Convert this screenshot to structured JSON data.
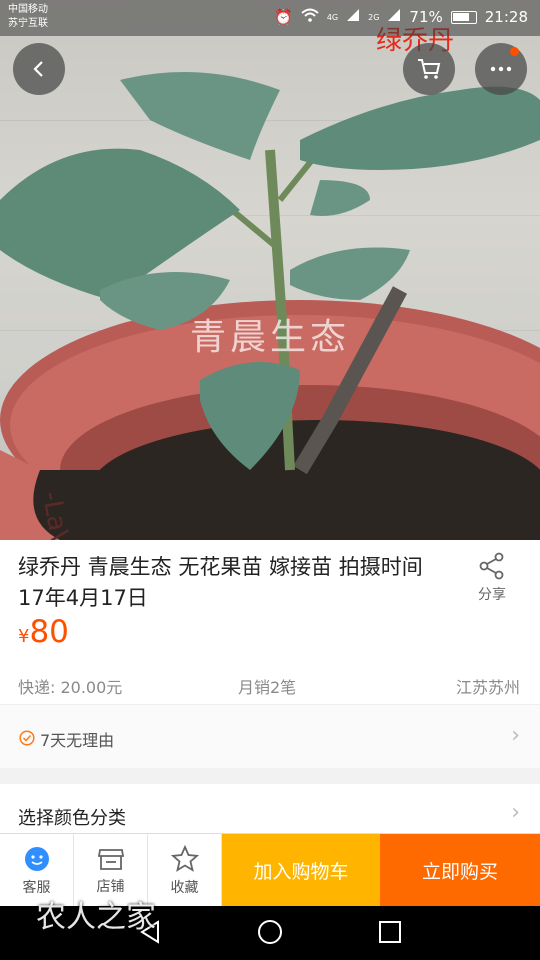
{
  "status": {
    "carrier_line1": "中国移动",
    "carrier_line2": "苏宁互联",
    "signal_net": "4G",
    "signal_net2": "2G",
    "battery": "71%",
    "time": "21:28"
  },
  "photo": {
    "overlay_name": "绿乔丹",
    "watermark": "青晨生态"
  },
  "product": {
    "title": "绿乔丹 青晨生态  无花果苗 嫁接苗 拍摄时间17年4月17日",
    "currency": "¥",
    "price": "80",
    "share_label": "分享",
    "shipping": "快递: 20.00元",
    "monthly_sales": "月销2笔",
    "location": "江苏苏州"
  },
  "guarantee": {
    "label": "7天无理由"
  },
  "sku": {
    "label": "选择颜色分类"
  },
  "actions": {
    "service": "客服",
    "store": "店铺",
    "favorite": "收藏",
    "add_to_cart": "加入购物车",
    "buy_now": "立即购买"
  },
  "watermark_logo": "农人之家",
  "colors": {
    "accent": "#ff5000",
    "cart": "#ffb500",
    "buy": "#ff6a00",
    "service_blue": "#2f8fff"
  }
}
